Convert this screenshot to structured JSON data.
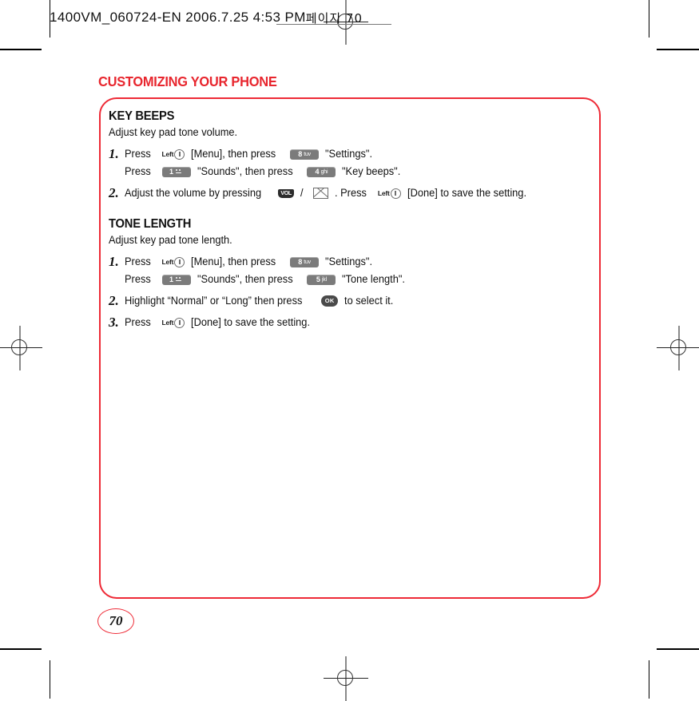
{
  "print_marks": {
    "file_info": "1400VM_060724-EN  2006.7.25 4:53 PM",
    "korean_suffix": "페이지 70",
    "registration_icon": "registration-crosshair-icon"
  },
  "chapter": {
    "title": "CUSTOMIZING YOUR PHONE"
  },
  "page": {
    "number": "70",
    "accent_color": "#ee2a36"
  },
  "sections": [
    {
      "heading": "KEY BEEPS",
      "subtitle": "Adjust key pad tone volume.",
      "steps": [
        {
          "number": "1.",
          "lines": [
            {
              "parts": [
                {
                  "type": "text",
                  "value": "Press"
                },
                {
                  "type": "icon",
                  "icon": "left-soft-key-icon",
                  "label": "Left"
                },
                {
                  "type": "text",
                  "value": "[Menu], then press"
                },
                {
                  "type": "icon",
                  "icon": "keypad-key-8-tuv-icon",
                  "digit": "8",
                  "letters": "tuv"
                },
                {
                  "type": "text",
                  "value": "\"Settings\"."
                }
              ]
            },
            {
              "parts": [
                {
                  "type": "text",
                  "value": "Press"
                },
                {
                  "type": "icon",
                  "icon": "keypad-key-1-voicemail-icon",
                  "digit": "1",
                  "letters": ""
                },
                {
                  "type": "text",
                  "value": "\"Sounds\", then press"
                },
                {
                  "type": "icon",
                  "icon": "keypad-key-4-ghi-icon",
                  "digit": "4",
                  "letters": "ghi"
                },
                {
                  "type": "text",
                  "value": "\"Key beeps\"."
                }
              ]
            }
          ]
        },
        {
          "number": "2.",
          "lines": [
            {
              "parts": [
                {
                  "type": "text",
                  "value": "Adjust the volume by pressing"
                },
                {
                  "type": "icon",
                  "icon": "volume-key-icon",
                  "label": "VOL"
                },
                {
                  "type": "text",
                  "value": "/"
                },
                {
                  "type": "icon",
                  "icon": "message-envelope-key-icon"
                },
                {
                  "type": "text",
                  "value": ".  Press"
                },
                {
                  "type": "icon",
                  "icon": "left-soft-key-icon",
                  "label": "Left"
                },
                {
                  "type": "text",
                  "value": "[Done] to save the setting."
                }
              ]
            }
          ]
        }
      ]
    },
    {
      "heading": "TONE LENGTH",
      "subtitle": "Adjust key pad tone length.",
      "steps": [
        {
          "number": "1.",
          "lines": [
            {
              "parts": [
                {
                  "type": "text",
                  "value": "Press"
                },
                {
                  "type": "icon",
                  "icon": "left-soft-key-icon",
                  "label": "Left"
                },
                {
                  "type": "text",
                  "value": "[Menu], then press"
                },
                {
                  "type": "icon",
                  "icon": "keypad-key-8-tuv-icon",
                  "digit": "8",
                  "letters": "tuv"
                },
                {
                  "type": "text",
                  "value": "\"Settings\"."
                }
              ]
            },
            {
              "parts": [
                {
                  "type": "text",
                  "value": "Press"
                },
                {
                  "type": "icon",
                  "icon": "keypad-key-1-voicemail-icon",
                  "digit": "1",
                  "letters": ""
                },
                {
                  "type": "text",
                  "value": "\"Sounds\", then press"
                },
                {
                  "type": "icon",
                  "icon": "keypad-key-5-jkl-icon",
                  "digit": "5",
                  "letters": "jkl"
                },
                {
                  "type": "text",
                  "value": "\"Tone length\"."
                }
              ]
            }
          ]
        },
        {
          "number": "2.",
          "lines": [
            {
              "parts": [
                {
                  "type": "text",
                  "value": "Highlight “Normal” or “Long” then press"
                },
                {
                  "type": "icon",
                  "icon": "ok-key-icon",
                  "label": "OK"
                },
                {
                  "type": "text",
                  "value": "to select it."
                }
              ]
            }
          ]
        },
        {
          "number": "3.",
          "lines": [
            {
              "parts": [
                {
                  "type": "text",
                  "value": "Press"
                },
                {
                  "type": "icon",
                  "icon": "left-soft-key-icon",
                  "label": "Left"
                },
                {
                  "type": "text",
                  "value": "[Done] to save the setting."
                }
              ]
            }
          ]
        }
      ]
    }
  ]
}
